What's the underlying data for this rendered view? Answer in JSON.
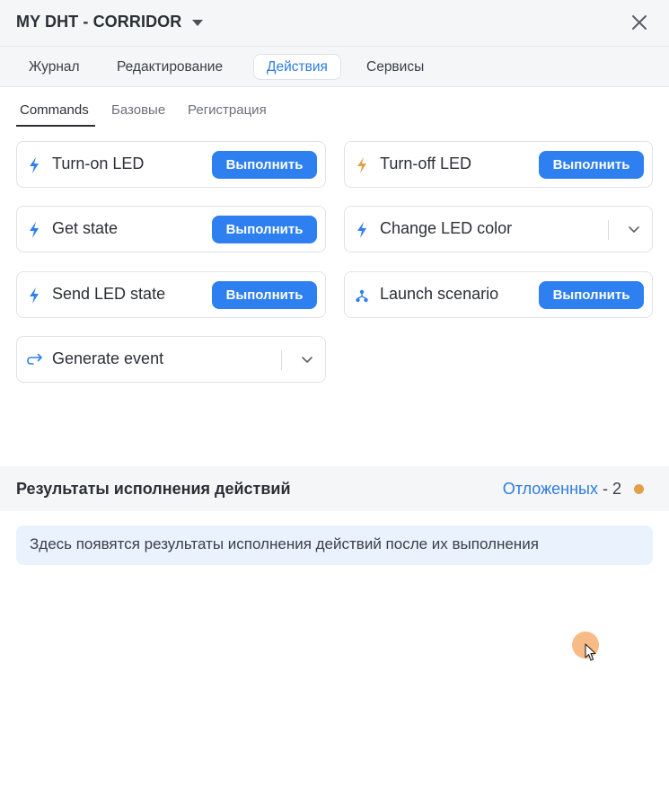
{
  "header": {
    "title": "MY DHT - CORRIDOR",
    "close_icon": "close-icon",
    "caret_icon": "caret-down-icon"
  },
  "tabs": [
    {
      "label": "Журнал",
      "active": false
    },
    {
      "label": "Редактирование",
      "active": false
    },
    {
      "label": "Действия",
      "active": true
    },
    {
      "label": "Сервисы",
      "active": false
    }
  ],
  "subtabs": [
    {
      "label": "Commands",
      "active": true
    },
    {
      "label": "Базовые",
      "active": false
    },
    {
      "label": "Регистрация",
      "active": false
    }
  ],
  "run_label": "Выполнить",
  "commands": [
    {
      "label": "Turn-on LED",
      "icon": "bolt-icon",
      "icon_color": "#2e7ff0",
      "control": "button"
    },
    {
      "label": "Turn-off LED",
      "icon": "bolt-icon",
      "icon_color": "#e3a04b",
      "control": "button"
    },
    {
      "label": "Get state",
      "icon": "bolt-icon",
      "icon_color": "#2e7ff0",
      "control": "button"
    },
    {
      "label": "Change LED color",
      "icon": "bolt-icon",
      "icon_color": "#2e7ff0",
      "control": "dropdown"
    },
    {
      "label": "Send LED state",
      "icon": "bolt-icon",
      "icon_color": "#2e7ff0",
      "control": "button"
    },
    {
      "label": "Launch scenario",
      "icon": "scenario-icon",
      "icon_color": "#2e7ff0",
      "control": "button"
    },
    {
      "label": "Generate event",
      "icon": "redirect-arrow-icon",
      "icon_color": "#2e7ff0",
      "control": "dropdown"
    }
  ],
  "results": {
    "title": "Результаты исполнения действий",
    "postponed_link": "Отложенных",
    "postponed_count": " - 2",
    "status_color": "#e3a04b",
    "empty_message": "Здесь появятся результаты исполнения действий после их выполнения"
  },
  "colors": {
    "accent": "#2e7ff0",
    "accent_text": "#2f7be0",
    "warning": "#e3a04b"
  }
}
